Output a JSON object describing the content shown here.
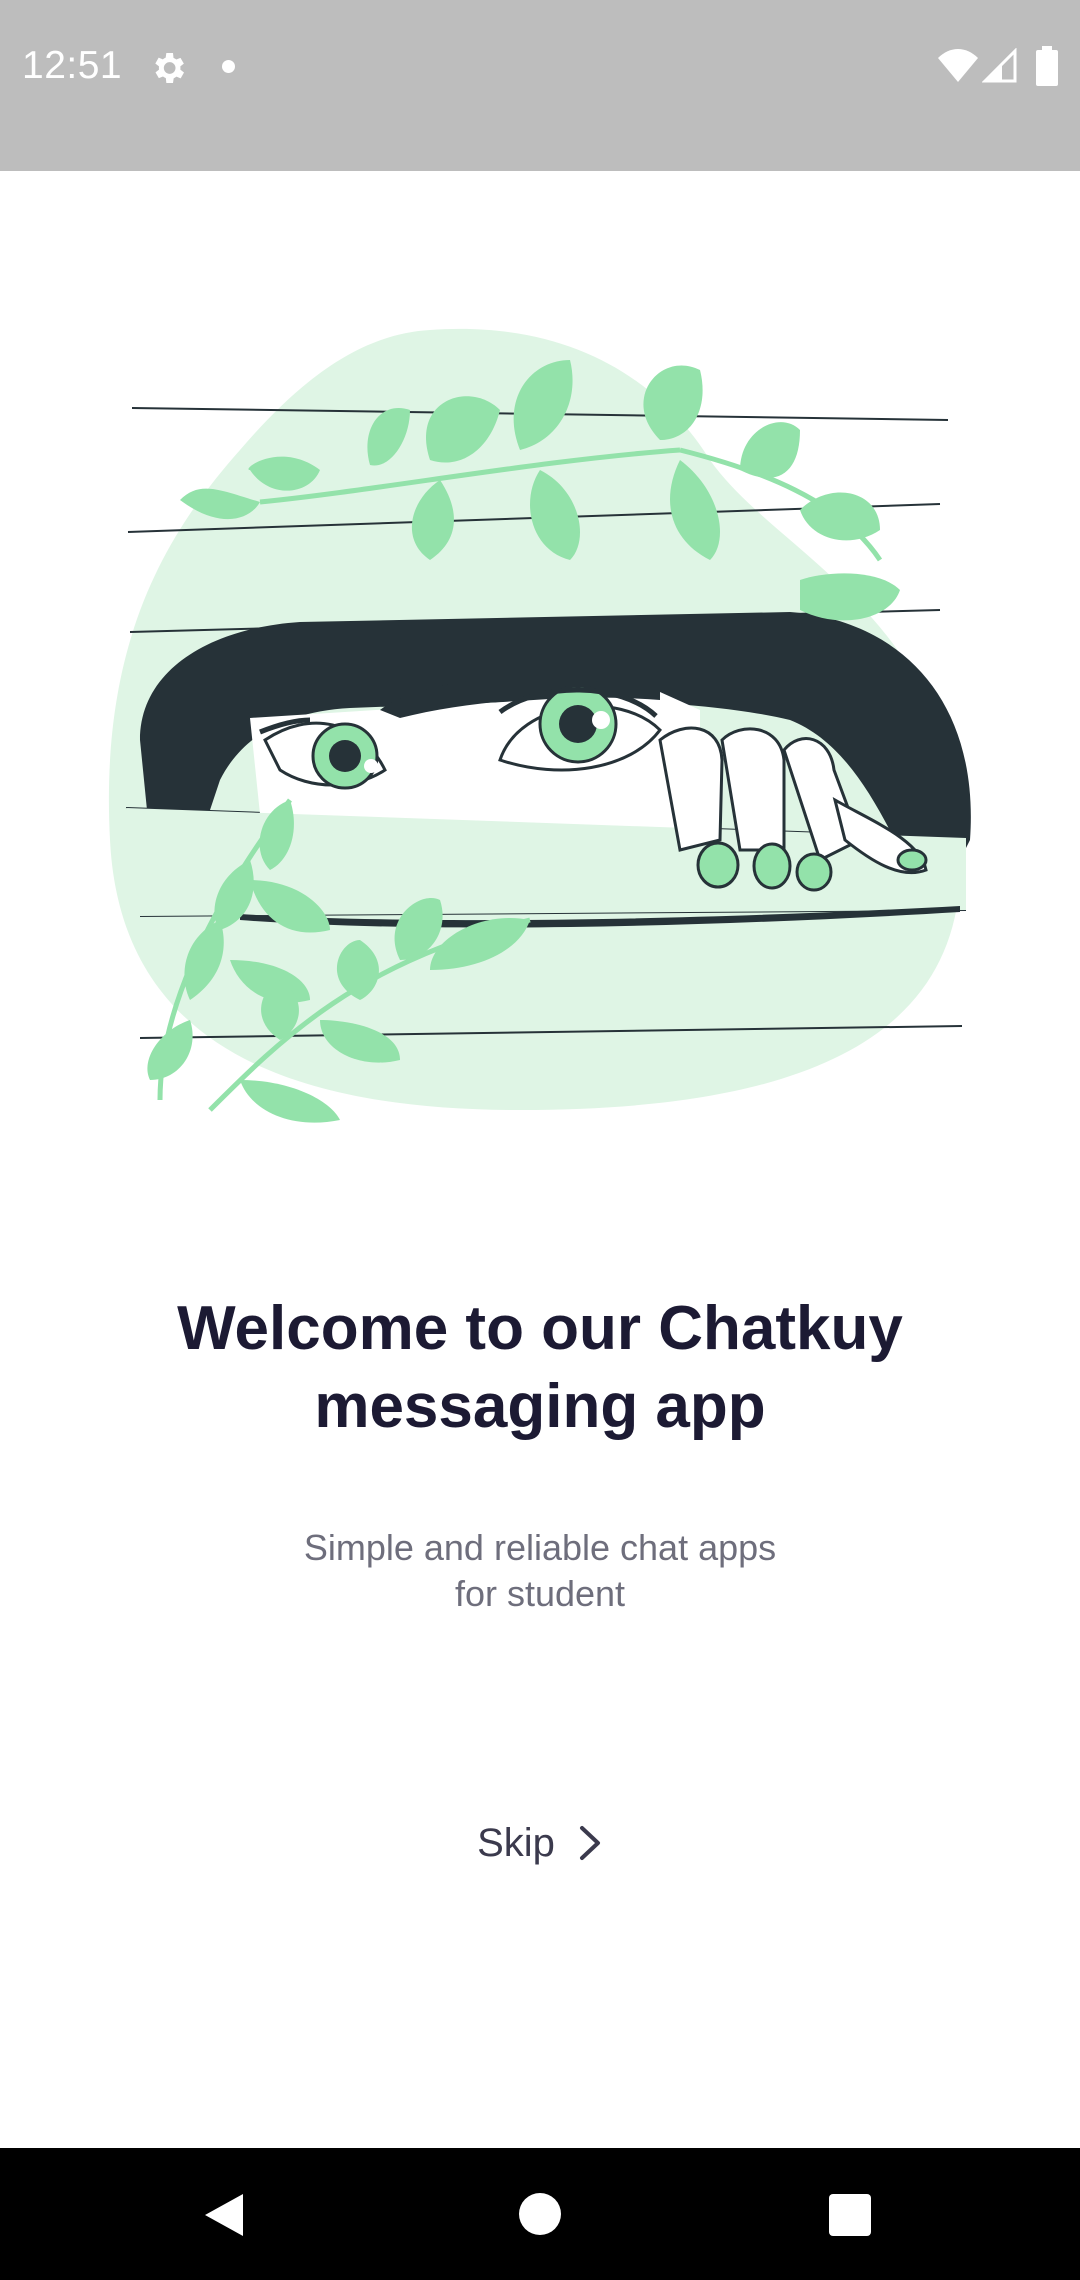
{
  "status_bar": {
    "time": "12:51",
    "icons": [
      "gear-icon",
      "notification-dot-icon",
      "wifi-icon",
      "signal-icon",
      "battery-icon"
    ]
  },
  "welcome": {
    "title_line1": "Welcome to our Chatkuy",
    "title_line2": "messaging app",
    "subtitle_line1": "Simple and reliable chat apps",
    "subtitle_line2": "for student"
  },
  "skip": {
    "label": "Skip",
    "icon": "chevron-right-icon"
  },
  "nav_bar": {
    "icons": [
      "back-icon",
      "home-icon",
      "recents-icon"
    ]
  },
  "colors": {
    "status_bar_bg": "#bdbdbd",
    "accent_green": "#93e2aa",
    "blob_green": "#dff5e5",
    "hair": "#263238",
    "title": "#1c1a33",
    "subtitle": "#6e6e7c"
  }
}
